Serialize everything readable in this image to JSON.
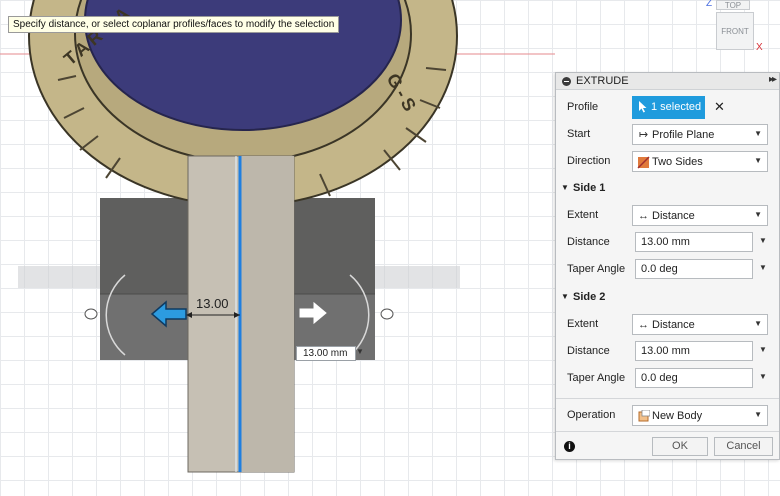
{
  "tooltip": "Specify distance, or select coplanar profiles/faces to modify the selection",
  "viewcube": {
    "top_label": "TOP",
    "front_label": "FRONT",
    "axis_z": "Z",
    "axis_x": "X"
  },
  "medallion_text": {
    "left": "TARGA",
    "right": "G-S"
  },
  "canvas": {
    "dimension_label": "13.00",
    "length_input_value": "13.00 mm"
  },
  "panel": {
    "title": "EXTRUDE",
    "expand_glyph": "▸▸",
    "profile_label": "Profile",
    "profile_selected": "1 selected",
    "profile_clear": "✕",
    "start_label": "Start",
    "start_value": "Profile Plane",
    "direction_label": "Direction",
    "direction_value": "Two Sides",
    "side1_title": "Side 1",
    "side1_extent_label": "Extent",
    "side1_extent_value": "Distance",
    "side1_distance_label": "Distance",
    "side1_distance_value": "13.00 mm",
    "side1_taper_label": "Taper Angle",
    "side1_taper_value": "0.0 deg",
    "side2_title": "Side 2",
    "side2_extent_label": "Extent",
    "side2_extent_value": "Distance",
    "side2_distance_label": "Distance",
    "side2_distance_value": "13.00 mm",
    "side2_taper_label": "Taper Angle",
    "side2_taper_value": "0.0 deg",
    "operation_label": "Operation",
    "operation_value": "New Body",
    "ok_label": "OK",
    "cancel_label": "Cancel",
    "info_glyph": "i"
  },
  "colors": {
    "accent": "#1f9bdd",
    "medallion_face": "#3c3b7a",
    "ring_gold": "#c4b689",
    "block_gray": "#6d6d6b",
    "bar_tan": "#c6c0b4",
    "axis_red": "#d8333a"
  },
  "icons": {
    "profile": "cursor-arrow-icon",
    "start": "profile-plane-icon",
    "direction": "two-sides-icon",
    "extent": "distance-icon",
    "operation": "new-body-icon",
    "info": "info-icon"
  }
}
